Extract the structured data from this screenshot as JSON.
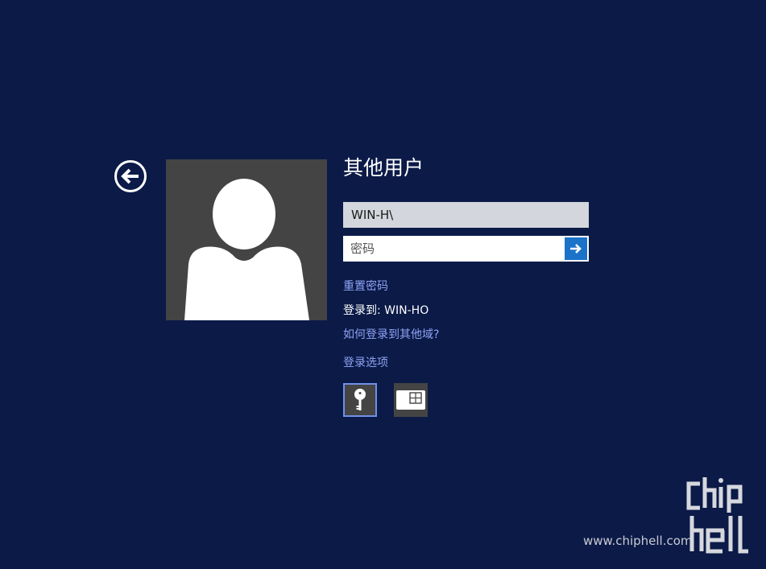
{
  "panel": {
    "title": "其他用户"
  },
  "username": {
    "value": "WIN-H\\"
  },
  "password": {
    "placeholder": "密码"
  },
  "links": {
    "reset_password": "重置密码",
    "sign_in_to": "登录到: WIN-HO",
    "other_domain": "如何登录到其他域?",
    "sign_in_options": "登录选项"
  },
  "watermark": {
    "site": "www.chiphell.com",
    "logo_text": "chiphell"
  },
  "icons": {
    "back": "back-arrow-icon",
    "submit": "arrow-right-icon",
    "password_option": "key-icon",
    "smartcard_option": "smart-card-icon"
  },
  "colors": {
    "background": "#0b1a47",
    "accent": "#1a73c9",
    "link": "#8ea3f4",
    "selected_border": "#6f90e8"
  }
}
